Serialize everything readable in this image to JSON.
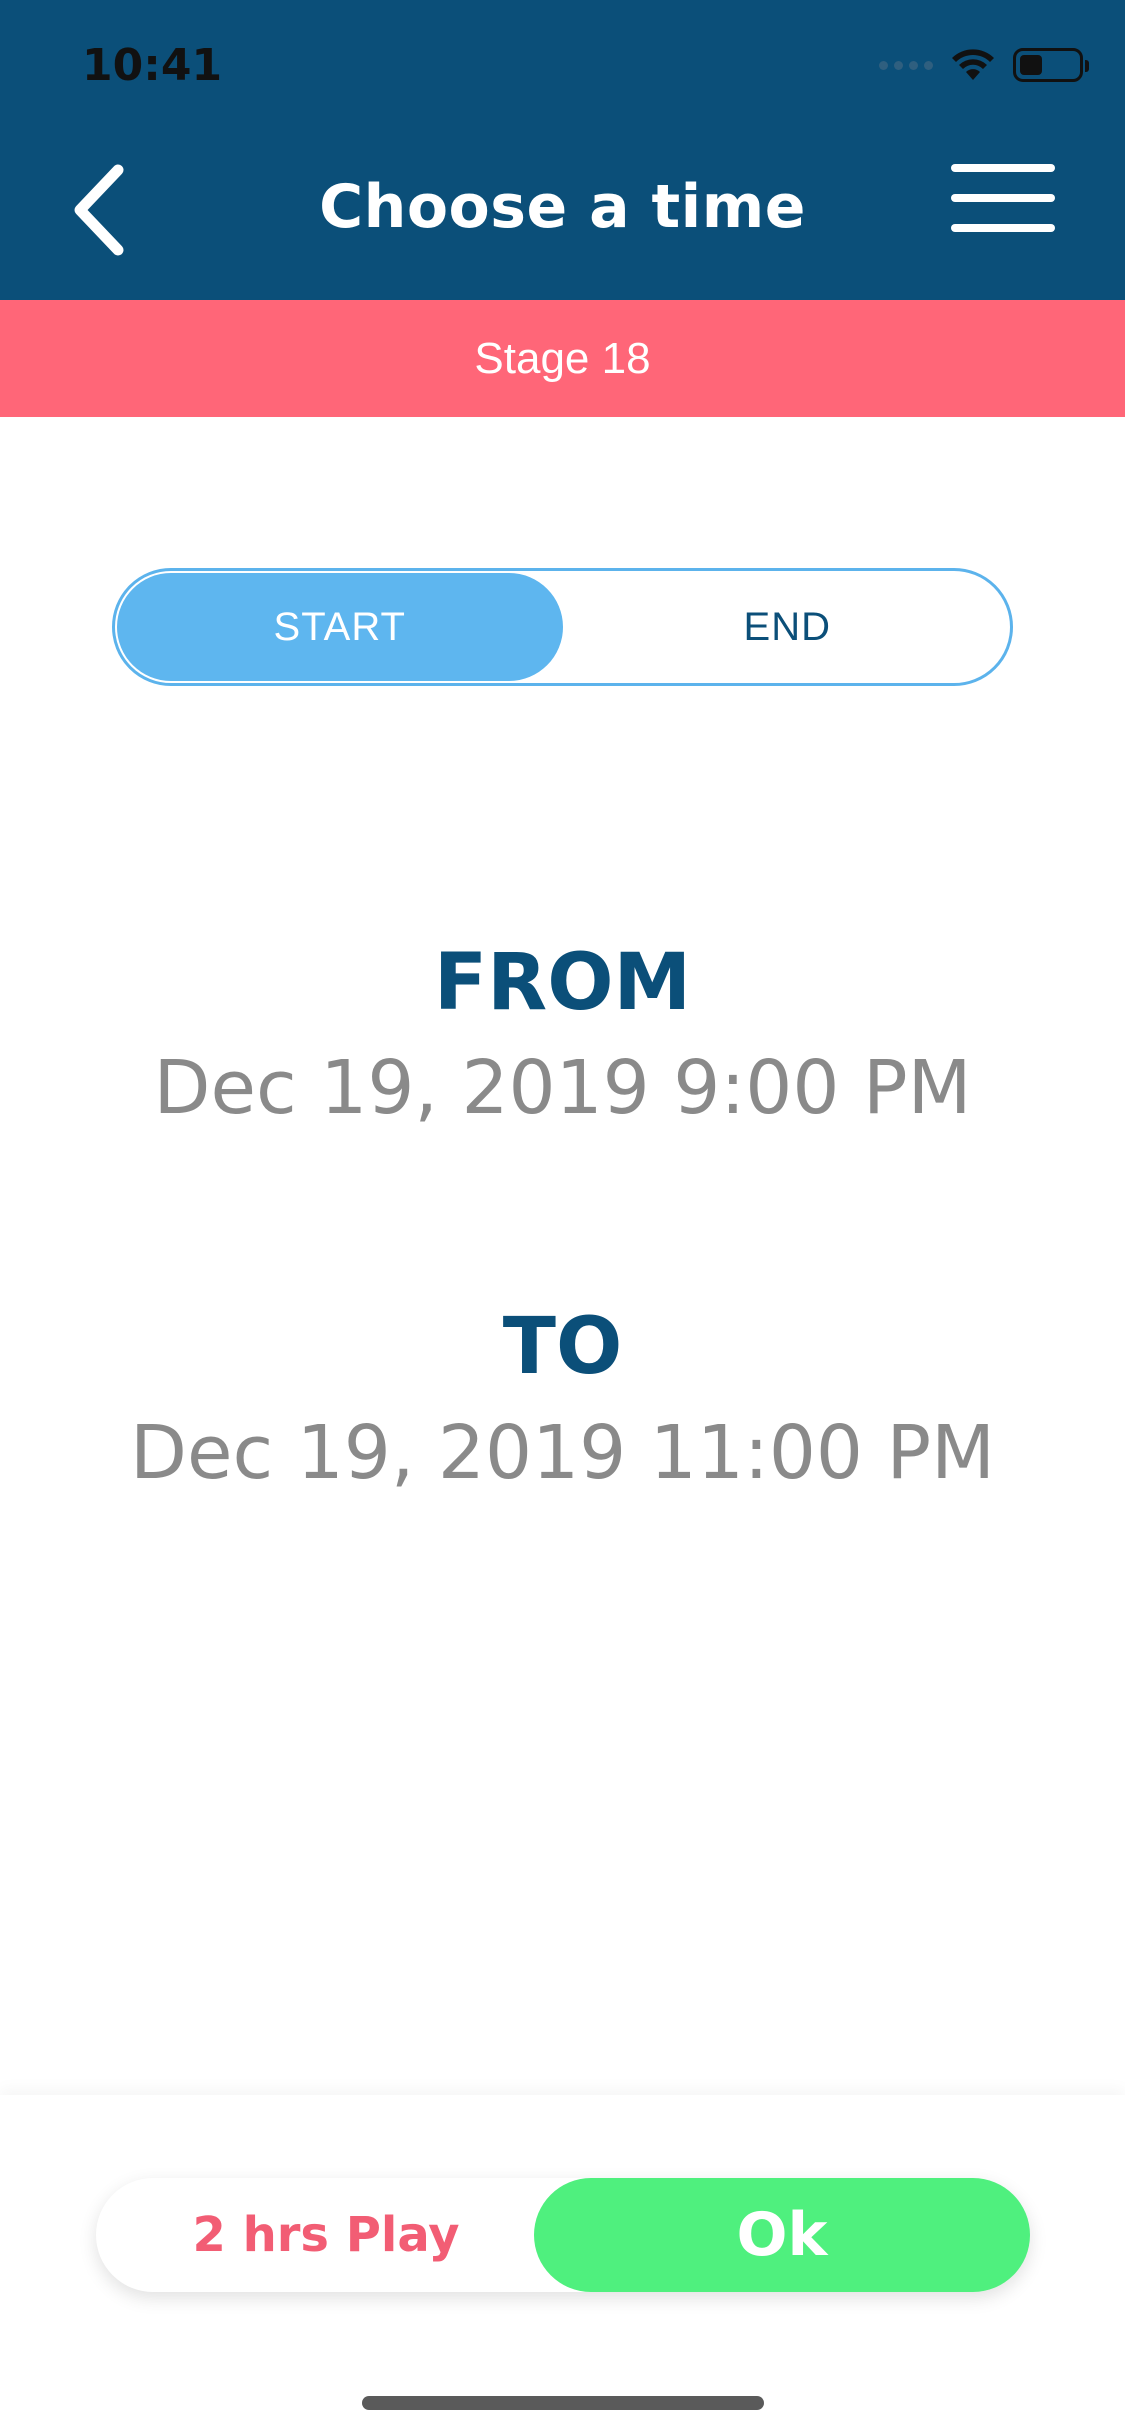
{
  "status_bar": {
    "time": "10:41"
  },
  "header": {
    "title": "Choose a time",
    "back_icon": "chevron-left-icon",
    "menu_icon": "hamburger-menu-icon",
    "background_color": "#0b4f79"
  },
  "stage": {
    "label": "Stage 18",
    "background_color": "#ff6678"
  },
  "segment": {
    "start_label": "START",
    "end_label": "END",
    "selected": "START",
    "accent_color": "#5eb6ef"
  },
  "time_range": {
    "from_label": "FROM",
    "from_value": "Dec 19, 2019 9:00 PM",
    "to_label": "TO",
    "to_value": "Dec 19, 2019 11:00 PM"
  },
  "footer": {
    "duration_label": "2 hrs Play",
    "ok_label": "Ok",
    "ok_color": "#4ff07e",
    "duration_color": "#f25d74"
  }
}
